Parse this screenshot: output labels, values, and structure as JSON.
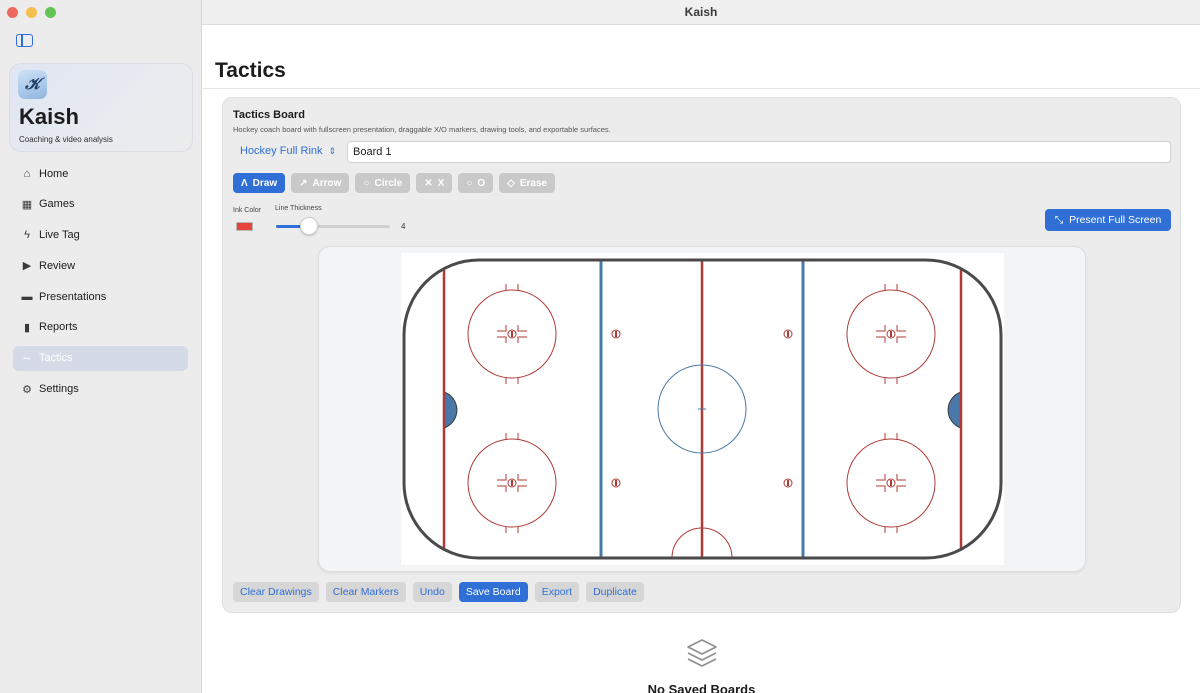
{
  "window": {
    "title": "Kaish"
  },
  "sidebar": {
    "brand": {
      "name": "Kaish",
      "subtitle": "Coaching & video analysis"
    },
    "items": [
      {
        "label": "Home",
        "icon": "house-icon"
      },
      {
        "label": "Games",
        "icon": "film-strip-icon"
      },
      {
        "label": "Live Tag",
        "icon": "bolt-icon"
      },
      {
        "label": "Review",
        "icon": "play-rectangle-icon"
      },
      {
        "label": "Presentations",
        "icon": "stack-icon"
      },
      {
        "label": "Reports",
        "icon": "bar-chart-icon"
      },
      {
        "label": "Tactics",
        "icon": "scribble-icon",
        "active": true
      },
      {
        "label": "Settings",
        "icon": "gear-icon"
      }
    ]
  },
  "main": {
    "title": "Tactics",
    "board": {
      "title": "Tactics Board",
      "description": "Hockey coach board with fullscreen presentation, draggable X/O markers, drawing tools, and exportable surfaces.",
      "rink_select": "Hockey Full Rink",
      "board_name": "Board 1",
      "tools": [
        {
          "label": "Draw",
          "icon": "pen-icon",
          "active": true
        },
        {
          "label": "Arrow",
          "icon": "arrow-icon"
        },
        {
          "label": "Circle",
          "icon": "circle-icon"
        },
        {
          "label": "X",
          "icon": "x-icon"
        },
        {
          "label": "O",
          "icon": "o-icon"
        },
        {
          "label": "Erase",
          "icon": "eraser-icon"
        }
      ],
      "ink_label": "Ink Color",
      "ink_color": "#e5453a",
      "thickness_label": "Line Thickness",
      "thickness_value": "4",
      "thickness_fraction": 0.29,
      "present_label": "Present Full Screen",
      "actions": [
        {
          "label": "Clear Drawings"
        },
        {
          "label": "Clear Markers"
        },
        {
          "label": "Undo"
        },
        {
          "label": "Save Board",
          "primary": true
        },
        {
          "label": "Export"
        },
        {
          "label": "Duplicate"
        }
      ]
    },
    "empty_state": {
      "title": "No Saved Boards"
    }
  },
  "colors": {
    "accent": "#2f6fd6",
    "rink_red": "#b03a36",
    "rink_blue": "#4a78a8",
    "boards": "#4a4a4a"
  }
}
